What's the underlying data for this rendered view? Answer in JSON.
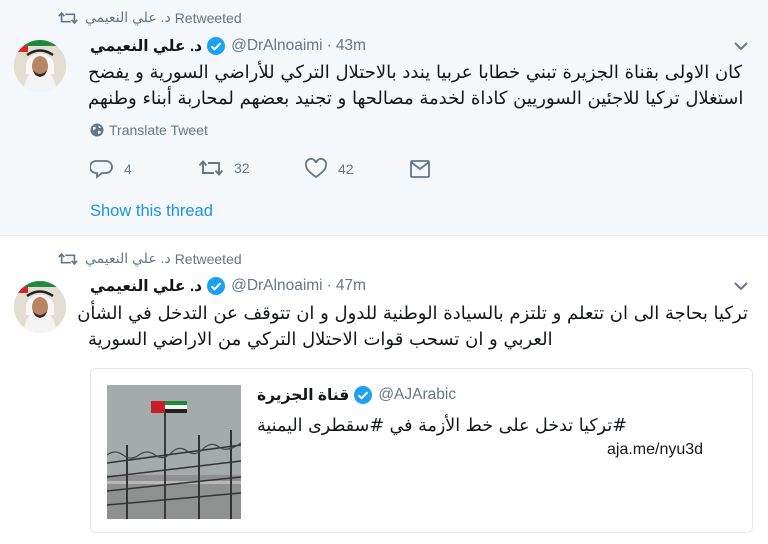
{
  "tweets": [
    {
      "retweeter": "د. علي النعيمي",
      "retweeted_label": "Retweeted",
      "author_name": "د. علي النعيمي",
      "handle": "@DrAlnoaimi",
      "time": "43m",
      "text_lines": [
        "كان الاولى بقناة الجزيرة تبني خطابا عربيا يندد بالاحتلال التركي للأراضي السورية و يفضح",
        "استغلال تركيا للاجئين السوريين كاداة لخدمة مصالحها و تجنيد بعضهم لمحاربة أبناء وطنهم"
      ],
      "translate_label": "Translate Tweet",
      "replies": "4",
      "retweets": "32",
      "likes": "42",
      "show_thread": "Show this thread"
    },
    {
      "retweeter": "د. علي النعيمي",
      "retweeted_label": "Retweeted",
      "author_name": "د. علي النعيمي",
      "handle": "@DrAlnoaimi",
      "time": "47m",
      "text_lines": [
        "تركيا بحاجة الى ان تتعلم و تلتزم بالسيادة الوطنية للدول و ان تتوقف عن التدخل في الشأن",
        "العربي و ان تسحب قوات الاحتلال التركي من الاراضي السورية"
      ],
      "card": {
        "name": "قناة الجزيرة",
        "handle": "@AJArabic",
        "text": "#تركيا تدخل على خط الأزمة في #سقطرى اليمنية",
        "link": "aja.me/nyu3d"
      }
    }
  ],
  "colors": {
    "accent": "#1b95e0",
    "muted": "#657786",
    "highlight_bg": "#f5f8fa",
    "verified": "#1da1f2"
  }
}
